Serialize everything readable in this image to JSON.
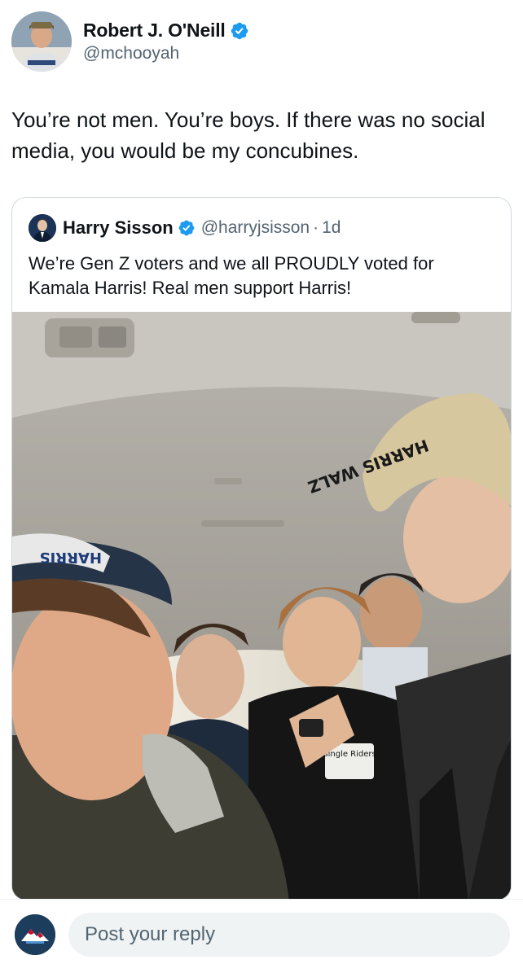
{
  "post": {
    "author": {
      "name": "Robert J. O'Neill",
      "handle": "@mchooyah",
      "verified": true
    },
    "text": "You’re not men. You’re boys. If there was no social media, you would be my concubines."
  },
  "quoted_post": {
    "author": {
      "name": "Harry Sisson",
      "handle": "@harryjsisson",
      "verified": true
    },
    "time_separator": "·",
    "time": "1d",
    "text": "We’re Gen Z voters and we all PROUDLY voted for Kamala Harris! Real men support Harris!",
    "media": {
      "icon": "photo-selfie-car",
      "hat_texts": [
        "HARRIS",
        "HARRIS WALZ"
      ],
      "shirt_text": "Single Riders"
    }
  },
  "reply": {
    "placeholder": "Post your reply"
  },
  "colors": {
    "verified": "#1d9bf0",
    "text_primary": "#0f1419",
    "text_secondary": "#536471",
    "border": "#cfd9de",
    "input_bg": "#eff3f4"
  }
}
